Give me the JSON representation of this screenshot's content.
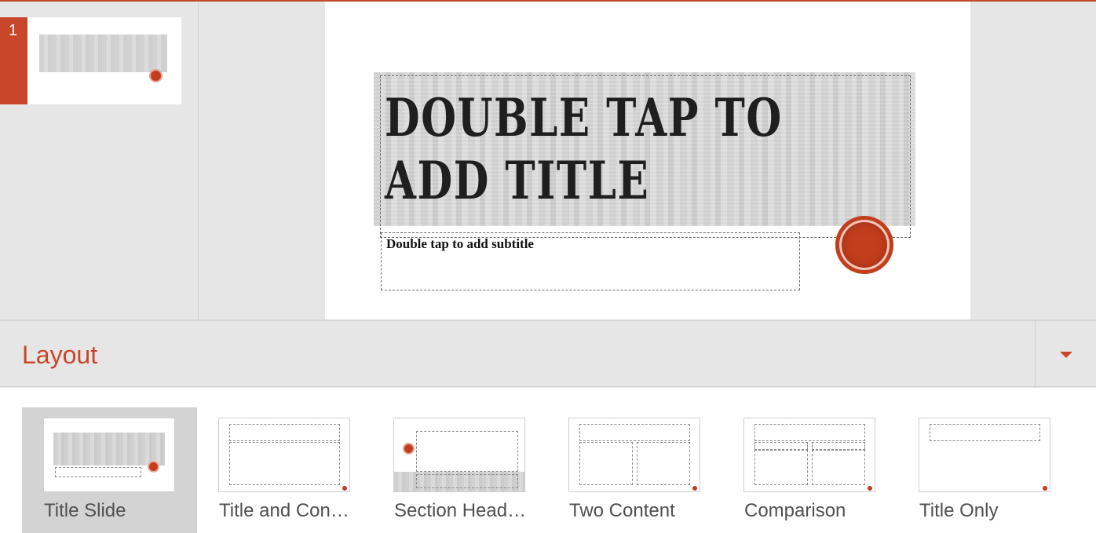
{
  "thumbnails": [
    {
      "number": "1"
    }
  ],
  "slide": {
    "title_placeholder": "Double tap to add title",
    "subtitle_placeholder": "Double tap to add subtitle"
  },
  "layout_panel": {
    "title": "Layout",
    "dropdown_icon": "chevron-down-icon",
    "items": [
      {
        "label": "Title Slide",
        "selected": true
      },
      {
        "label": "Title and Con…",
        "selected": false
      },
      {
        "label": "Section Head…",
        "selected": false
      },
      {
        "label": "Two Content",
        "selected": false
      },
      {
        "label": "Comparison",
        "selected": false
      },
      {
        "label": "Title Only",
        "selected": false
      }
    ]
  },
  "colors": {
    "accent": "#c8472a",
    "stamp": "#c23e1d",
    "background": "#e6e6e6"
  }
}
